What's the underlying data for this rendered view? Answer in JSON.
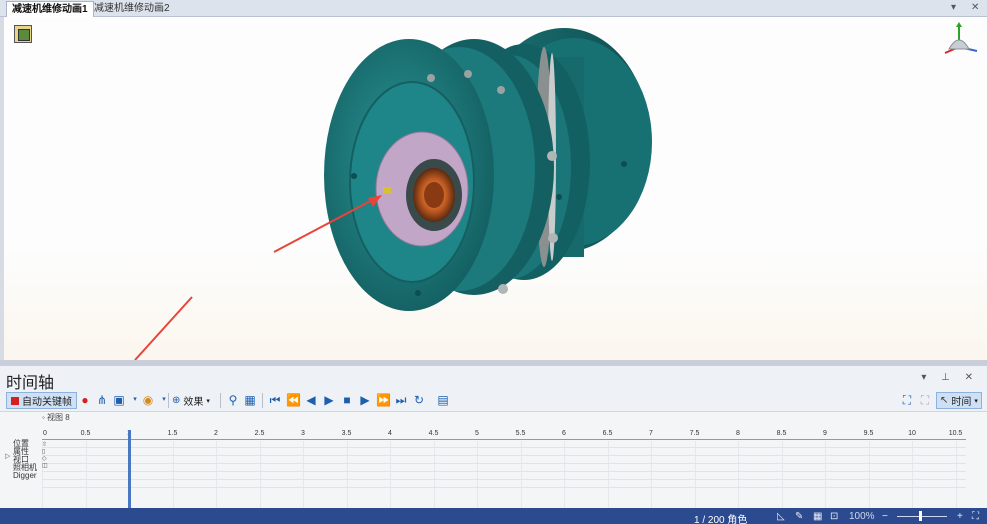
{
  "tabs": [
    {
      "label": "减速机维修动画1"
    },
    {
      "label": "减速机维修动画2"
    }
  ],
  "tab_controls": {
    "dropdown": "▾",
    "close": "✕"
  },
  "timeline_panel": {
    "title": "时间轴",
    "controls": "▾ ⊥ ✕",
    "toolbar": {
      "autokey_label": "自动关键帧",
      "effects_label": "效果",
      "time_label": "时间",
      "autokey_color": "#d42020"
    },
    "view_label": "◦ 视图 8",
    "ruler_ticks": [
      "0",
      "0.5",
      "1",
      "1.5",
      "2",
      "2.5",
      "3",
      "3.5",
      "4",
      "4.5",
      "5",
      "5.5",
      "6",
      "6.5",
      "7",
      "7.5",
      "8",
      "8.5",
      "9",
      "9.5",
      "10",
      "10.5"
    ],
    "playhead_time": 1,
    "row_labels": [
      "位置",
      "属性",
      "视口",
      "照相机",
      "Digger"
    ],
    "row_icons": [
      "⇧",
      "▯",
      "◇",
      "◫"
    ]
  },
  "status_bar": {
    "frame_text": "1 / 200 角色",
    "zoom_text": "100%",
    "zoom_minus": "−",
    "zoom_plus": "+"
  },
  "colors": {
    "model_teal": "#1f7f80",
    "annotation_arrow": "#e8443a",
    "status_bar": "#2c4a8f",
    "playhead": "#4a77c4"
  }
}
